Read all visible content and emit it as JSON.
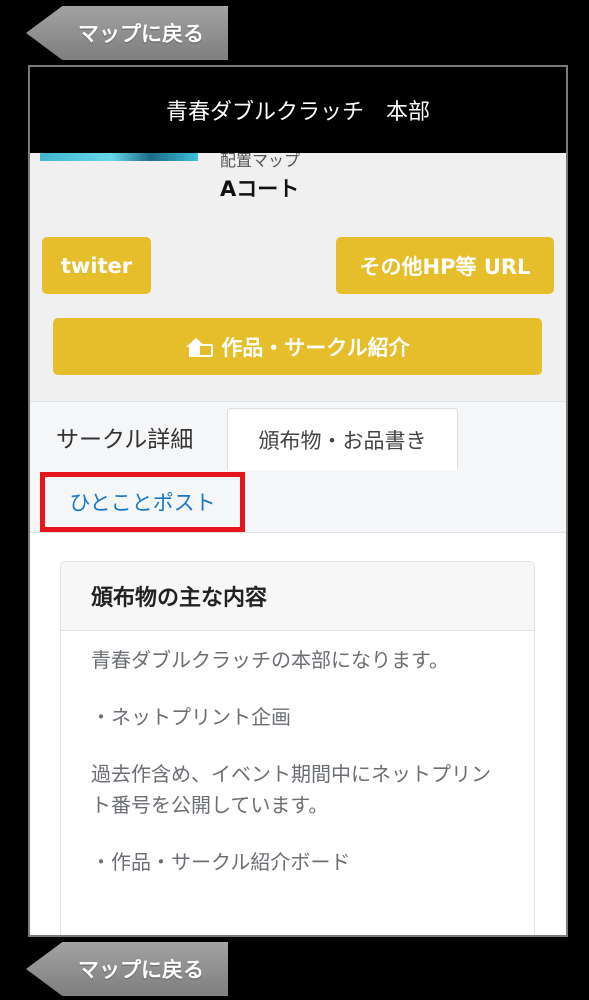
{
  "nav": {
    "back_label": "マップに戻る"
  },
  "header": {
    "title": "青春ダブルクラッチ　本部"
  },
  "location": {
    "map_label": "配置マップ",
    "court": "Aコート"
  },
  "buttons": {
    "twitter": "twiter",
    "other_url": "その他HP等 URL",
    "intro": "作品・サークル紹介"
  },
  "tabs": [
    {
      "label": "サークル詳細",
      "active": false
    },
    {
      "label": "頒布物・お品書き",
      "active": true
    },
    {
      "label": "ひとことポスト",
      "highlighted": true
    }
  ],
  "card": {
    "title": "頒布物の主な内容",
    "paragraphs": [
      "青春ダブルクラッチの本部になります。",
      "・ネットプリント企画",
      "過去作含め、イベント期間中にネットプリント番号を公開しています。",
      "・作品・サークル紹介ボード"
    ]
  },
  "colors": {
    "accent_button": "#e6be2b",
    "highlight_border": "#e8141b",
    "link": "#1a78c8",
    "background": "#000000"
  }
}
